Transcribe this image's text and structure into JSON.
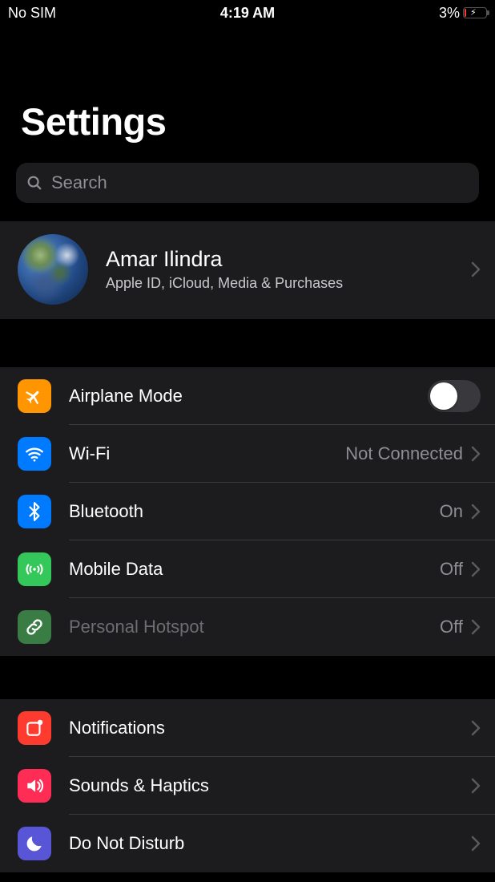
{
  "statusBar": {
    "carrier": "No SIM",
    "time": "4:19 AM",
    "batteryPercent": "3%"
  },
  "page": {
    "title": "Settings"
  },
  "search": {
    "placeholder": "Search"
  },
  "account": {
    "name": "Amar Ilindra",
    "subtitle": "Apple ID, iCloud, Media & Purchases"
  },
  "groups": [
    {
      "id": "connectivity",
      "items": [
        {
          "id": "airplane-mode",
          "label": "Airplane Mode",
          "icon": "airplane",
          "iconColor": "bg-orange",
          "control": "toggle",
          "toggleOn": false
        },
        {
          "id": "wifi",
          "label": "Wi-Fi",
          "icon": "wifi",
          "iconColor": "bg-blue",
          "control": "link",
          "value": "Not Connected"
        },
        {
          "id": "bluetooth",
          "label": "Bluetooth",
          "icon": "bluetooth",
          "iconColor": "bg-blue",
          "control": "link",
          "value": "On"
        },
        {
          "id": "mobile-data",
          "label": "Mobile Data",
          "icon": "antenna",
          "iconColor": "bg-green",
          "control": "link",
          "value": "Off"
        },
        {
          "id": "personal-hotspot",
          "label": "Personal Hotspot",
          "icon": "link",
          "iconColor": "bg-dgreen",
          "control": "link",
          "value": "Off",
          "disabled": true
        }
      ]
    },
    {
      "id": "alerts",
      "items": [
        {
          "id": "notifications",
          "label": "Notifications",
          "icon": "notification",
          "iconColor": "bg-red",
          "control": "link"
        },
        {
          "id": "sounds-haptics",
          "label": "Sounds & Haptics",
          "icon": "speaker",
          "iconColor": "bg-pink",
          "control": "link"
        },
        {
          "id": "do-not-disturb",
          "label": "Do Not Disturb",
          "icon": "moon",
          "iconColor": "bg-purple",
          "control": "link"
        }
      ]
    }
  ]
}
